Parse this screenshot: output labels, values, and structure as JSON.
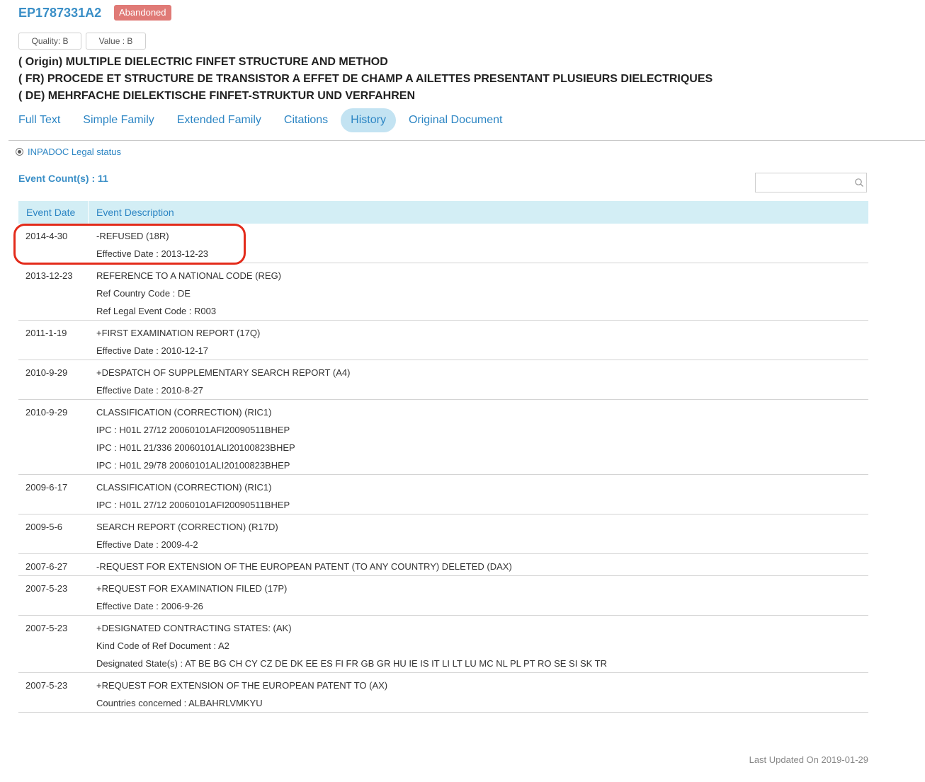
{
  "header": {
    "patent_number": "EP1787331A2",
    "status": "Abandoned",
    "quality": "Quality: B",
    "value": "Value : B",
    "titles": [
      "( Origin) MULTIPLE DIELECTRIC FINFET STRUCTURE AND METHOD",
      "( FR) PROCEDE ET STRUCTURE DE TRANSISTOR A EFFET DE CHAMP A AILETTES PRESENTANT PLUSIEURS DIELECTRIQUES",
      "( DE) MEHRFACHE DIELEKTISCHE FINFET-STRUKTUR UND VERFAHREN"
    ]
  },
  "tabs": [
    {
      "label": "Full Text"
    },
    {
      "label": "Simple Family"
    },
    {
      "label": "Extended Family"
    },
    {
      "label": "Citations"
    },
    {
      "label": "History",
      "active": true
    },
    {
      "label": "Original Document"
    }
  ],
  "legal_status": {
    "label": "INPADOC Legal status",
    "selected": true
  },
  "event_count": "Event Count(s) : 11",
  "search": {
    "placeholder": "",
    "value": ""
  },
  "table": {
    "headers": {
      "date": "Event Date",
      "description": "Event Description"
    },
    "rows": [
      {
        "date": "2014-4-30",
        "lines": [
          "-REFUSED (18R)",
          "Effective Date : 2013-12-23"
        ]
      },
      {
        "date": "2013-12-23",
        "lines": [
          "REFERENCE TO A NATIONAL CODE (REG)",
          "Ref Country Code : DE",
          "Ref Legal Event Code : R003"
        ]
      },
      {
        "date": "2011-1-19",
        "lines": [
          "+FIRST EXAMINATION REPORT (17Q)",
          "Effective Date : 2010-12-17"
        ]
      },
      {
        "date": "2010-9-29",
        "lines": [
          "+DESPATCH OF SUPPLEMENTARY SEARCH REPORT (A4)",
          "Effective Date : 2010-8-27"
        ]
      },
      {
        "date": "2010-9-29",
        "lines": [
          "CLASSIFICATION (CORRECTION) (RIC1)",
          "IPC : H01L 27/12 20060101AFI20090511BHEP",
          "IPC : H01L 21/336 20060101ALI20100823BHEP",
          "IPC : H01L 29/78 20060101ALI20100823BHEP"
        ]
      },
      {
        "date": "2009-6-17",
        "lines": [
          "CLASSIFICATION (CORRECTION) (RIC1)",
          "IPC : H01L 27/12 20060101AFI20090511BHEP"
        ]
      },
      {
        "date": "2009-5-6",
        "lines": [
          "SEARCH REPORT (CORRECTION) (R17D)",
          "Effective Date : 2009-4-2"
        ]
      },
      {
        "date": "2007-6-27",
        "lines": [
          "-REQUEST FOR EXTENSION OF THE EUROPEAN PATENT (TO ANY COUNTRY) DELETED (DAX)"
        ]
      },
      {
        "date": "2007-5-23",
        "lines": [
          "+REQUEST FOR EXAMINATION FILED (17P)",
          "Effective Date : 2006-9-26"
        ]
      },
      {
        "date": "2007-5-23",
        "lines": [
          "+DESIGNATED CONTRACTING STATES: (AK)",
          "Kind Code of Ref Document : A2",
          "Designated State(s) : AT BE BG CH CY CZ DE DK EE ES FI FR GB GR HU IE IS IT LI LT LU MC NL PL PT RO SE SI SK TR"
        ]
      },
      {
        "date": "2007-5-23",
        "lines": [
          "+REQUEST FOR EXTENSION OF THE EUROPEAN PATENT TO (AX)",
          "Countries concerned : ALBAHRLVMKYU"
        ]
      }
    ]
  },
  "last_updated": "Last Updated On 2019-01-29",
  "colors": {
    "accent": "#3a8fc7",
    "badge": "#e07a76",
    "header_bg": "#d3eef5",
    "highlight": "#e32b1b"
  }
}
